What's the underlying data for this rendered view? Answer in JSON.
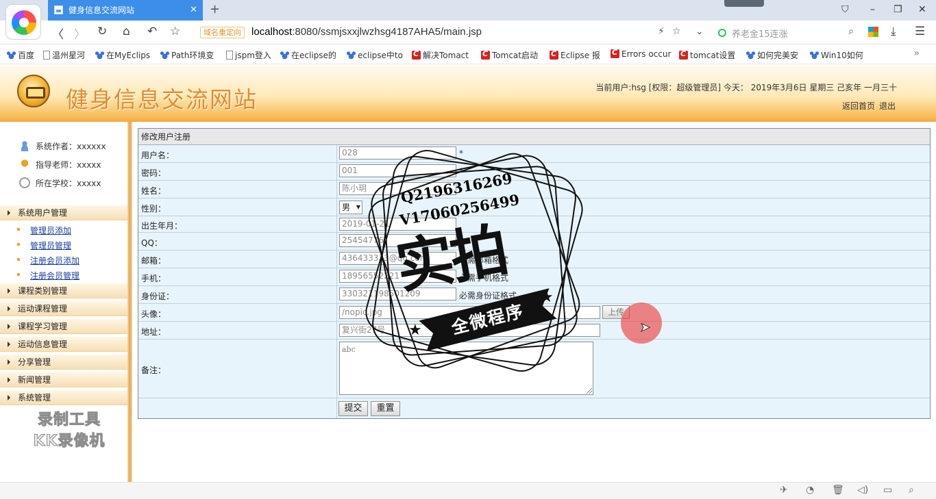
{
  "browser": {
    "tab_title": "健身信息交流网站",
    "tab_close": "✕",
    "new_tab": "+",
    "domain_badge": "域名重定向",
    "url_host": "localhost",
    "url_path": ":8080/ssmjsxxjlwzhsg4187AHA5/main.jsp",
    "search_placeholder": "养老金15连涨",
    "bookmarks": [
      "百度",
      "温州星河",
      "在MyEclips",
      "Path环境变",
      "jspm登入",
      "在eclipse的",
      "eclipse中to",
      "解决Tomact",
      "Tomcat启动",
      "Eclipse 报",
      "Errors occur",
      "tomcat设置",
      "如何完美安",
      "Win10如何"
    ],
    "bookmarks_more": "»"
  },
  "header": {
    "site_title": "健身信息交流网站",
    "user_info": "当前用户:hsg [权限：超级管理员] 今天： 2019年3月6日 星期三 己亥年 一月三十",
    "home_link": "返回首页",
    "logout_link": "退出"
  },
  "sidebar": {
    "author": "系统作者：xxxxxx",
    "teacher": "指导老师：xxxxx",
    "school": "所在学校：xxxxx",
    "menu": [
      {
        "label": "系统用户管理"
      },
      {
        "label": "课程类别管理"
      },
      {
        "label": "运动课程管理"
      },
      {
        "label": "课程学习管理"
      },
      {
        "label": "运动信息管理"
      },
      {
        "label": "分享管理"
      },
      {
        "label": "新闻管理"
      },
      {
        "label": "系统管理"
      }
    ],
    "submenu": [
      "管理员添加",
      "管理员管理",
      "注册会员添加",
      "注册会员管理"
    ],
    "watermark_line1": "录制工具",
    "watermark_line2": "KK录像机"
  },
  "form": {
    "title": "修改用户注册",
    "labels": {
      "username": "用户名：",
      "password": "密码：",
      "name": "姓名：",
      "gender": "性别：",
      "birth": "出生年月：",
      "qq": "QQ：",
      "email": "邮箱：",
      "phone": "手机：",
      "idcard": "身份证：",
      "avatar": "头像：",
      "address": "地址：",
      "remark": "备注："
    },
    "values": {
      "username": "028",
      "password": "001",
      "name": "陈小玥",
      "gender": "男",
      "birth": "2019-01-21",
      "qq": "25454776",
      "email": "436433333@qq.com",
      "phone": "18956552221",
      "idcard": "330321198501209",
      "avatar": "/nopic.jpg",
      "address": "复兴街27号",
      "remark": "abc"
    },
    "required_mark": "*",
    "hints": {
      "email": "必需邮箱格式",
      "phone": "必需手机格式",
      "idcard": "必需身份证格式"
    },
    "upload_label": "上传",
    "submit_label": "提交",
    "reset_label": "重置"
  },
  "stamp": {
    "line1": "Q2196316269",
    "line2": "V17060256499",
    "big_text": "实拍",
    "banner_text": "全微程序"
  }
}
